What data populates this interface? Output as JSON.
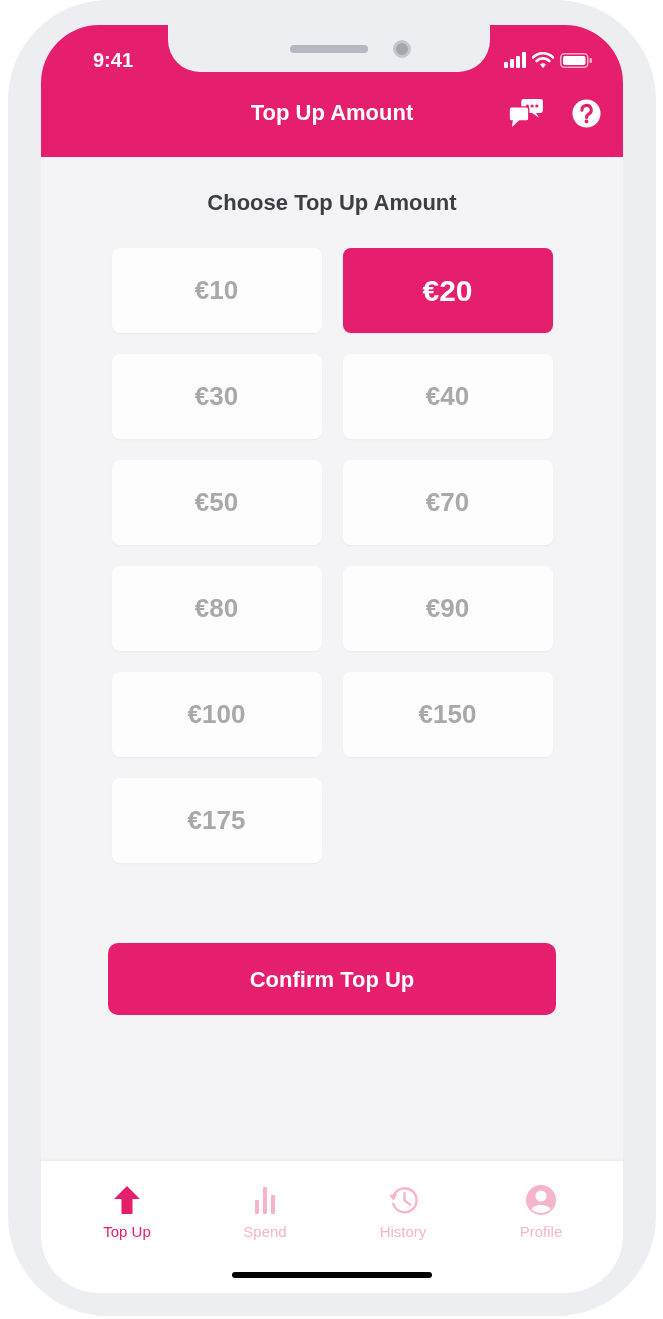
{
  "status_bar": {
    "time": "9:41"
  },
  "header": {
    "title": "Top Up Amount"
  },
  "heading": "Choose Top Up Amount",
  "amounts": [
    {
      "label": "€10",
      "selected": false
    },
    {
      "label": "€20",
      "selected": true
    },
    {
      "label": "€30",
      "selected": false
    },
    {
      "label": "€40",
      "selected": false
    },
    {
      "label": "€50",
      "selected": false
    },
    {
      "label": "€70",
      "selected": false
    },
    {
      "label": "€80",
      "selected": false
    },
    {
      "label": "€90",
      "selected": false
    },
    {
      "label": "€100",
      "selected": false
    },
    {
      "label": "€150",
      "selected": false
    },
    {
      "label": "€175",
      "selected": false
    }
  ],
  "confirm_button": {
    "label": "Confirm Top Up"
  },
  "tabs": [
    {
      "label": "Top Up",
      "kind": "arrow",
      "selected": true
    },
    {
      "label": "Spend",
      "kind": "bars",
      "selected": false
    },
    {
      "label": "History",
      "kind": "clock",
      "selected": false
    },
    {
      "label": "Profile",
      "kind": "person",
      "selected": false
    }
  ]
}
